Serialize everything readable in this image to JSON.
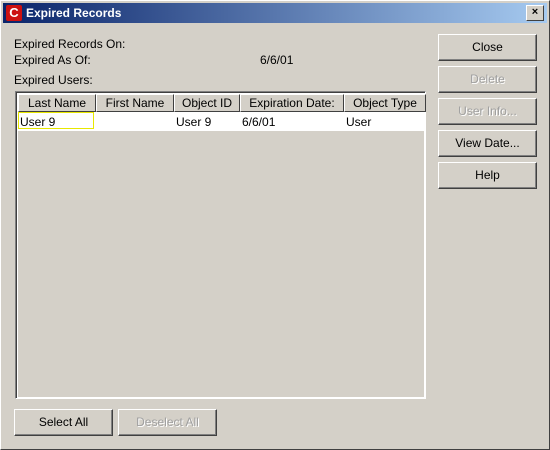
{
  "window": {
    "title": "Expired Records",
    "icon_name": "app-c-icon",
    "close_glyph": "×"
  },
  "info": {
    "records_on_label": "Expired Records On:",
    "as_of_label": "Expired As Of:",
    "as_of_value": "6/6/01",
    "users_label": "Expired Users:"
  },
  "table": {
    "columns": [
      "Last Name",
      "First Name",
      "Object ID",
      "Expiration Date:",
      "Object Type"
    ],
    "rows": [
      {
        "last_name": "User 9",
        "first_name": "",
        "object_id": "User 9",
        "expiration_date": "6/6/01",
        "object_type": "User"
      }
    ]
  },
  "side_buttons": {
    "close": "Close",
    "delete": "Delete",
    "user_info": "User Info...",
    "view_date": "View Date...",
    "help": "Help"
  },
  "bottom_buttons": {
    "select_all": "Select All",
    "deselect_all": "Deselect All"
  },
  "colors": {
    "title_start": "#0a246a",
    "title_end": "#a6caf0",
    "focus": "#e8e800"
  }
}
